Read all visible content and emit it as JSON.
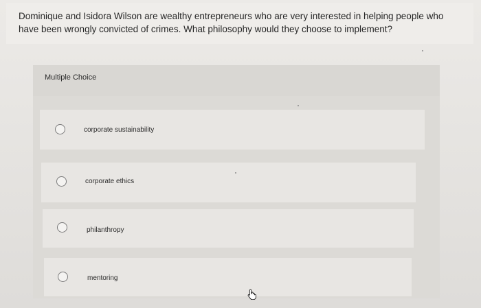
{
  "question": {
    "text": "Dominique and Isidora Wilson are wealthy entrepreneurs who are very interested in helping people who have been wrongly convicted of crimes. What philosophy would they choose to implement?"
  },
  "multiple_choice": {
    "header_label": "Multiple Choice",
    "options": [
      {
        "label": "corporate sustainability",
        "selected": false
      },
      {
        "label": "corporate ethics",
        "selected": false
      },
      {
        "label": "philanthropy",
        "selected": false
      },
      {
        "label": "mentoring",
        "selected": false
      }
    ]
  },
  "cursor": {
    "icon": "hand-pointer-icon"
  }
}
